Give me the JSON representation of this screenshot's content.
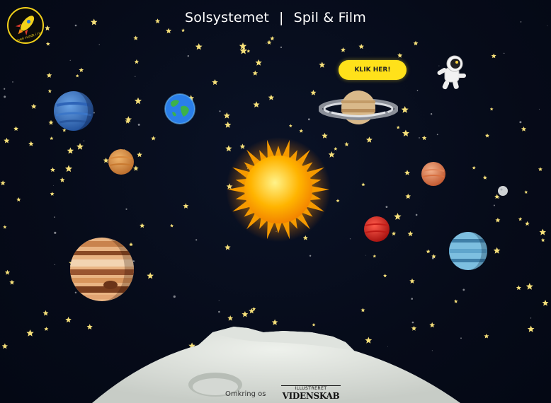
{
  "nav": {
    "title": "Solsystemet",
    "separator": "|",
    "link": "Spil & Film"
  },
  "logo": {
    "text": "Rejsen rundt i rummet"
  },
  "cta": {
    "label": "KLIK HER!"
  },
  "footer": {
    "about_link": "Omkring os",
    "brand_top": "ILLUSTRERET",
    "brand_bottom": "VIDENSKAB"
  },
  "colors": {
    "background": "#060b19",
    "cta": "#ffe11a",
    "star": "#f6e07a",
    "moon": "#d9ddd8"
  },
  "icons": [
    "rocket-icon",
    "astronaut-icon",
    "sun-icon",
    "moon-surface"
  ]
}
